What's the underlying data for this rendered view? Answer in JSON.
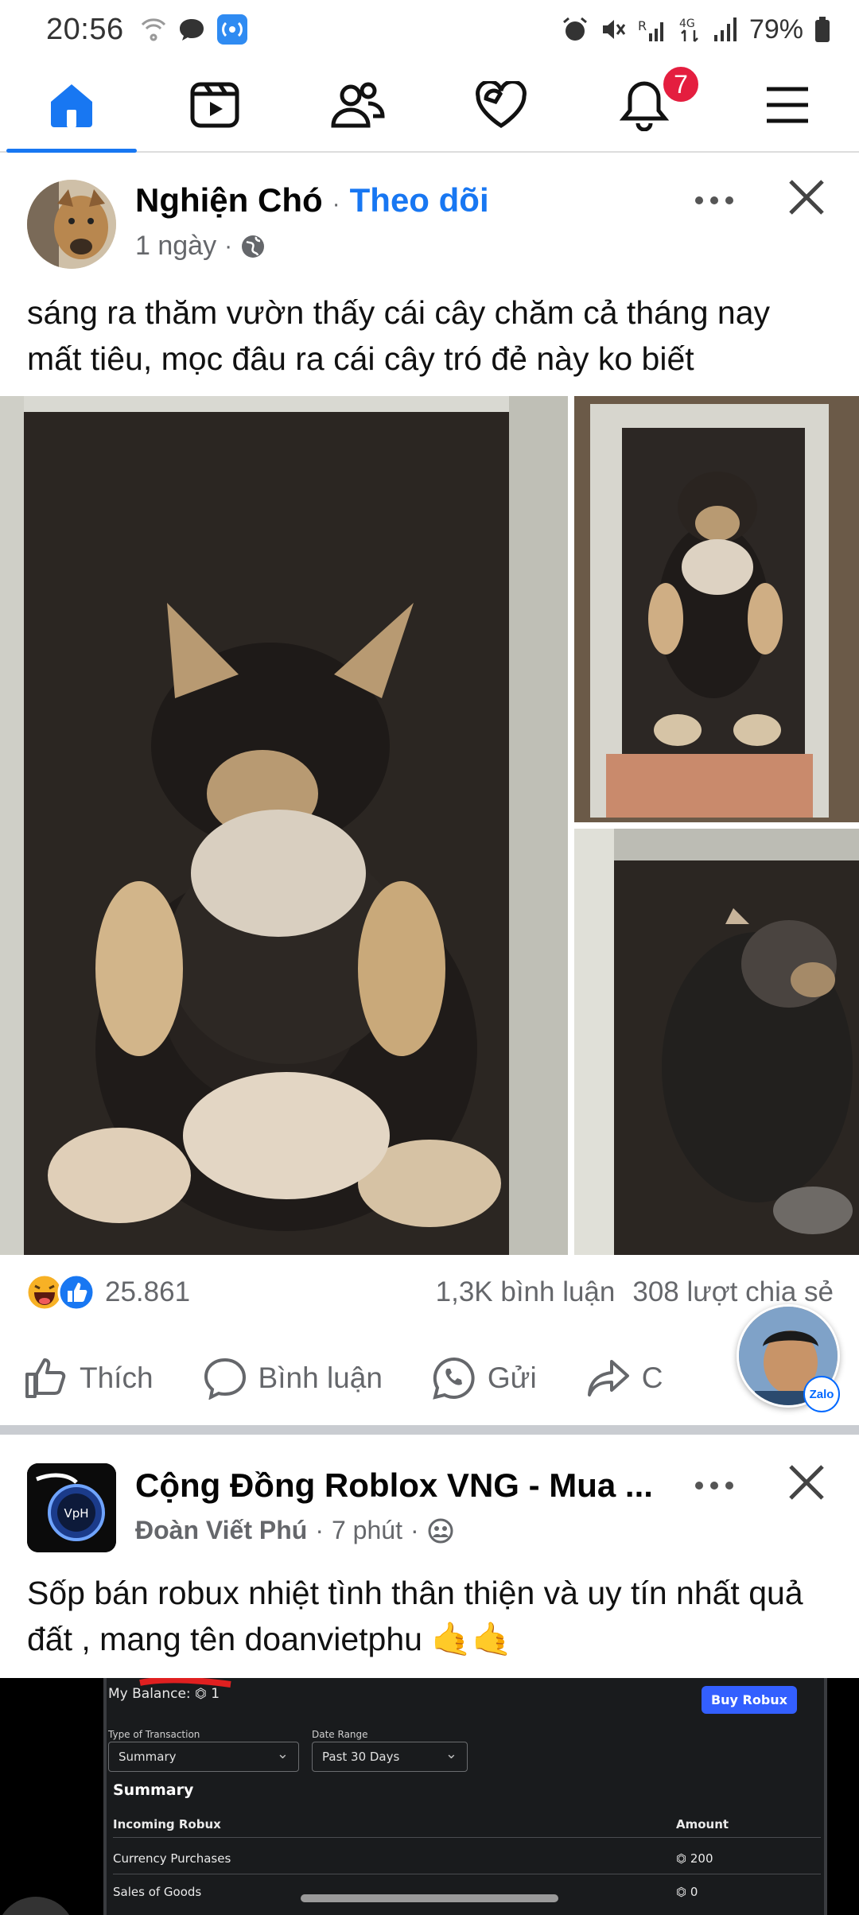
{
  "status_bar": {
    "time": "20:56",
    "battery": "79%",
    "signal_labels": [
      "R",
      "4G"
    ]
  },
  "nav": {
    "items": [
      "home",
      "video",
      "friends",
      "dating",
      "notifications",
      "menu"
    ],
    "notifications_badge": "7",
    "accent": "#1877f2"
  },
  "post1": {
    "author": "Nghiện Chó",
    "separator": "·",
    "follow": "Theo dõi",
    "time": "1 ngày",
    "text": "sáng ra thăm vườn thấy cái cây chăm cả tháng nay mất tiêu, mọc đâu ra cái cây tró đẻ này ko biết",
    "reaction_count": "25.861",
    "comments": "1,3K bình luận",
    "shares": "308 lượt chia sẻ",
    "actions": {
      "like": "Thích",
      "comment": "Bình luận",
      "send": "Gửi",
      "share_partial": "C"
    }
  },
  "zalo": {
    "label": "Zalo"
  },
  "post2": {
    "group": "Cộng Đồng Roblox VNG - Mua ...",
    "author": "Đoàn Viết Phú",
    "time": "7 phút",
    "text": "Sốp bán robux nhiệt tình thân thiện và uy tín nhất quả đất , mang tên doanvietphu 🤙🤙",
    "avatar_text": "VpH"
  },
  "robux_screen": {
    "balance": "My Balance: ⏣ 1",
    "buy": "Buy Robux",
    "type_label": "Type of Transaction",
    "type_value": "Summary",
    "range_label": "Date Range",
    "range_value": "Past 30 Days",
    "summary": "Summary",
    "incoming": "Incoming Robux",
    "amount": "Amount",
    "rows": [
      {
        "name": "Currency Purchases",
        "amount": "⏣ 200"
      },
      {
        "name": "Sales of Goods",
        "amount": "⏣ 0"
      }
    ]
  }
}
